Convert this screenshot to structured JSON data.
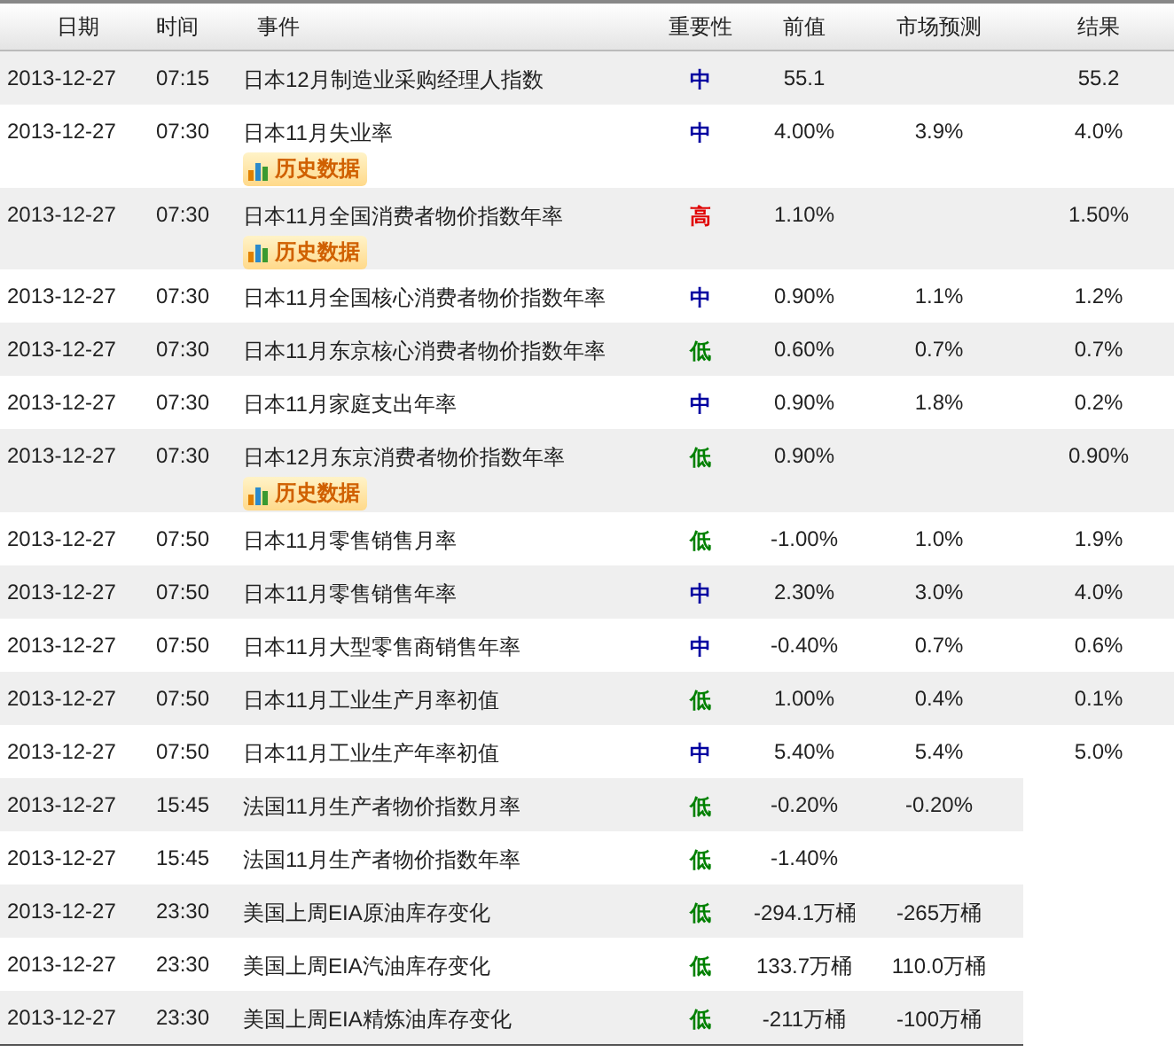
{
  "columns": [
    "日期",
    "时间",
    "事件",
    "重要性",
    "前值",
    "市场预测",
    "结果"
  ],
  "rows": [
    {
      "date": "2013-12-27",
      "time": "07:15",
      "event": "日本12月制造业采购经理人指数",
      "importance": "中",
      "color": "#0000a0",
      "previous": "55.1",
      "result": "55.2"
    },
    {
      "date": "2013-12-27",
      "time": "07:30",
      "event": "日本11月失业率",
      "history_badge": "历史数据",
      "importance": "中",
      "color": "#0000a0",
      "previous": "4.00%",
      "forecast": "3.9%",
      "result": "4.0%"
    },
    {
      "date": "2013-12-27",
      "time": "07:30",
      "event": "日本11月全国消费者物价指数年率",
      "history_badge": "历史数据",
      "importance": "高",
      "color": "#e00000",
      "previous": "1.10%",
      "result": "1.50%"
    },
    {
      "date": "2013-12-27",
      "time": "07:30",
      "event": "日本11月全国核心消费者物价指数年率",
      "importance": "中",
      "color": "#0000a0",
      "previous": "0.90%",
      "forecast": "1.1%",
      "result": "1.2%"
    },
    {
      "date": "2013-12-27",
      "time": "07:30",
      "event": "日本11月东京核心消费者物价指数年率",
      "importance": "低",
      "color": "#008000",
      "previous": "0.60%",
      "forecast": "0.7%",
      "result": "0.7%"
    },
    {
      "date": "2013-12-27",
      "time": "07:30",
      "event": "日本11月家庭支出年率",
      "importance": "中",
      "color": "#0000a0",
      "previous": "0.90%",
      "forecast": "1.8%",
      "result": "0.2%"
    },
    {
      "date": "2013-12-27",
      "time": "07:30",
      "event": "日本12月东京消费者物价指数年率",
      "history_badge": "历史数据",
      "importance": "低",
      "color": "#008000",
      "previous": "0.90%",
      "result": "0.90%"
    },
    {
      "date": "2013-12-27",
      "time": "07:50",
      "event": "日本11月零售销售月率",
      "importance": "低",
      "color": "#008000",
      "previous": "-1.00%",
      "forecast": "1.0%",
      "result": "1.9%"
    },
    {
      "date": "2013-12-27",
      "time": "07:50",
      "event": "日本11月零售销售年率",
      "importance": "中",
      "color": "#0000a0",
      "previous": "2.30%",
      "forecast": "3.0%",
      "result": "4.0%"
    },
    {
      "date": "2013-12-27",
      "time": "07:50",
      "event": "日本11月大型零售商销售年率",
      "importance": "中",
      "color": "#0000a0",
      "previous": "-0.40%",
      "forecast": "0.7%",
      "result": "0.6%"
    },
    {
      "date": "2013-12-27",
      "time": "07:50",
      "event": "日本11月工业生产月率初值",
      "importance": "低",
      "color": "#008000",
      "previous": "1.00%",
      "forecast": "0.4%",
      "result": "0.1%"
    },
    {
      "date": "2013-12-27",
      "time": "07:50",
      "event": "日本11月工业生产年率初值",
      "importance": "中",
      "color": "#0000a0",
      "previous": "5.40%",
      "forecast": "5.4%",
      "result": "5.0%"
    },
    {
      "date": "2013-12-27",
      "time": "15:45",
      "event": "法国11月生产者物价指数月率",
      "importance": "低",
      "color": "#008000",
      "previous": "-0.20%",
      "forecast": "-0.20%"
    },
    {
      "date": "2013-12-27",
      "time": "15:45",
      "event": "法国11月生产者物价指数年率",
      "importance": "低",
      "color": "#008000",
      "previous": "-1.40%"
    },
    {
      "date": "2013-12-27",
      "time": "23:30",
      "event": "美国上周EIA原油库存变化",
      "importance": "低",
      "color": "#008000",
      "previous": "-294.1万桶",
      "forecast": "-265万桶"
    },
    {
      "date": "2013-12-27",
      "time": "23:30",
      "event": "美国上周EIA汽油库存变化",
      "importance": "低",
      "color": "#008000",
      "previous": "133.7万桶",
      "forecast": "110.0万桶"
    },
    {
      "date": "2013-12-27",
      "time": "23:30",
      "event": "美国上周EIA精炼油库存变化",
      "importance": "低",
      "color": "#008000",
      "previous": "-211万桶",
      "forecast": "-100万桶"
    }
  ]
}
